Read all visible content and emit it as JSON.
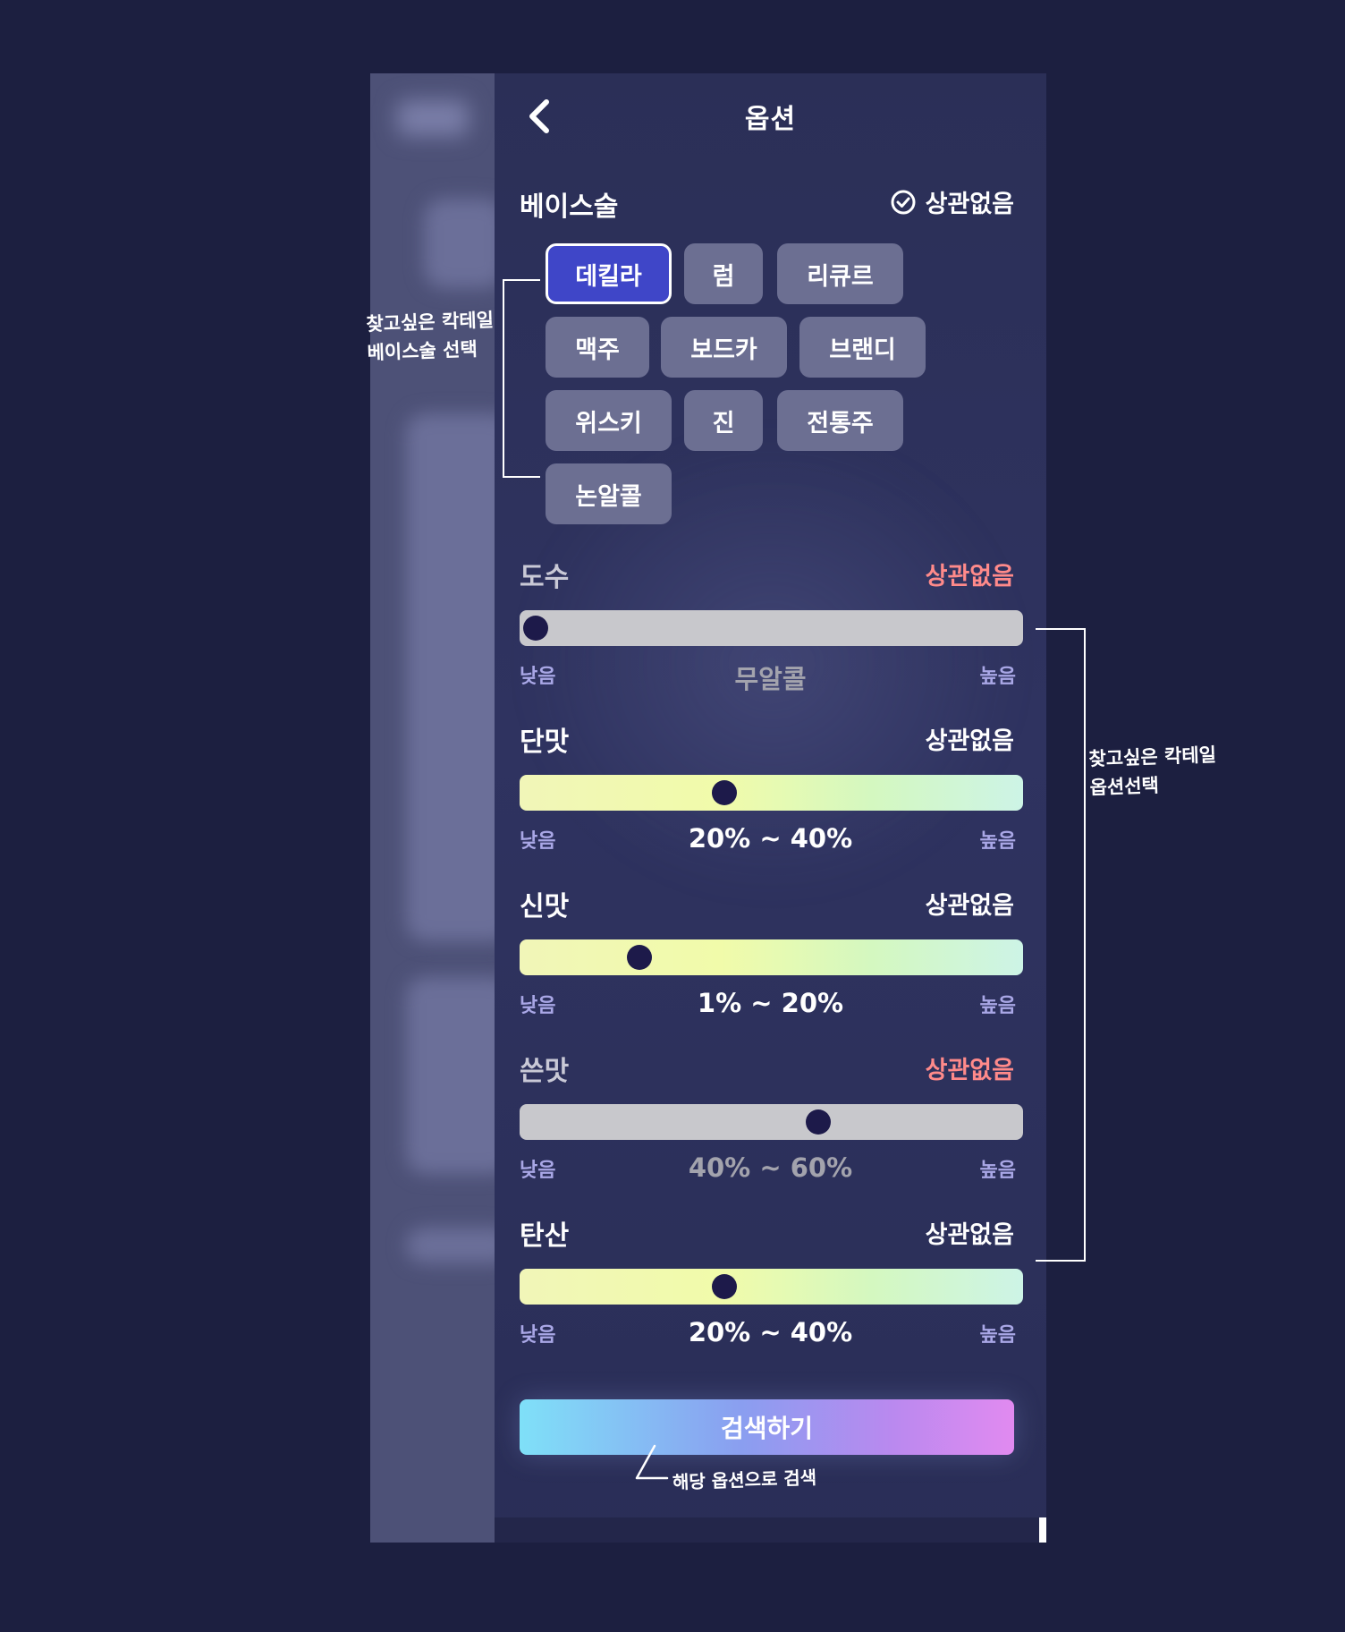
{
  "header": {
    "title": "옵션"
  },
  "base_spirit": {
    "title": "베이스술",
    "any_label": "상관없음",
    "options": [
      "데킬라",
      "럼",
      "리큐르",
      "맥주",
      "보드카",
      "브랜디",
      "위스키",
      "진",
      "전통주",
      "논알콜"
    ],
    "selected": "데킬라"
  },
  "sliders": [
    {
      "title": "도수",
      "any_label": "상관없음",
      "low": "낮음",
      "high": "높음",
      "value": "무알콜",
      "level": 0.0,
      "active": false
    },
    {
      "title": "단맛",
      "any_label": "상관없음",
      "low": "낮음",
      "high": "높음",
      "value": "20% ~ 40%",
      "level": 0.4,
      "active": true
    },
    {
      "title": "신맛",
      "any_label": "상관없음",
      "low": "낮음",
      "high": "높음",
      "value": "1% ~ 20%",
      "level": 0.22,
      "active": true
    },
    {
      "title": "쓴맛",
      "any_label": "상관없음",
      "low": "낮음",
      "high": "높음",
      "value": "40% ~ 60%",
      "level": 0.6,
      "active": false
    },
    {
      "title": "탄산",
      "any_label": "상관없음",
      "low": "낮음",
      "high": "높음",
      "value": "20% ~ 40%",
      "level": 0.4,
      "active": true
    }
  ],
  "search_button": {
    "label": "검색하기"
  },
  "annotations": {
    "base_note": "찾고싶은 칵테일\n베이스술 선택",
    "options_note": "찾고싶은 칵테일\n옵션선택",
    "search_note": "해당 옵션으로 검색"
  },
  "colors": {
    "background": "#1c1f40",
    "panel": "#2d315b",
    "chip": "#6c6f92",
    "chip_selected": "#3f46c8",
    "any_inactive": "#ff8a8a",
    "range_label": "#a9a7e6",
    "knob": "#1d1a4a"
  },
  "icons": {
    "back": "chevron-left-icon",
    "check": "check-circle-icon"
  }
}
